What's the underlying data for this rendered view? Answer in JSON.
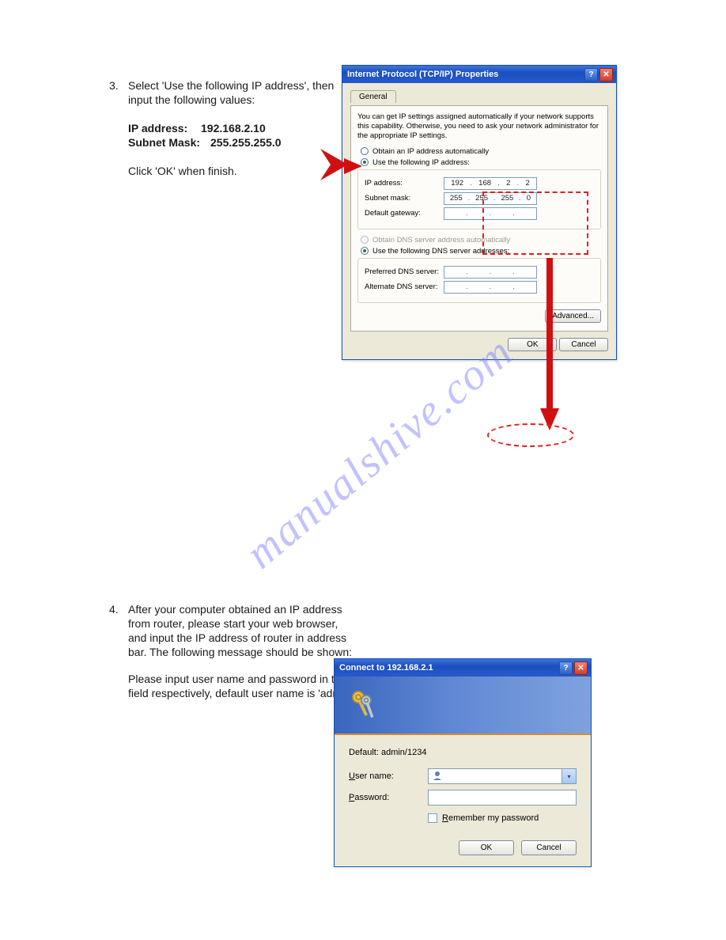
{
  "doc": {
    "step3_num": "3.",
    "step3_text_a": "Select 'Use the following IP address', then",
    "step3_text_b": "input the following values:",
    "ip_label": "IP address:",
    "ip_val": "192.168.2.10",
    "mask_label": "Subnet Mask:",
    "mask_val": "255.255.255.0",
    "step3_click_ok": "Click 'OK' when finish.",
    "step4_num": "4.",
    "step4_a": "After your computer obtained an IP address",
    "step4_b": "from router, please start your web browser,",
    "step4_c": "and input the IP address of router in address",
    "step4_d": "bar. The following message should be shown:",
    "step5": "Please input user name and password in the",
    "step5b": "field respectively, default user name is 'admin',",
    "watermark": "manualshive.com"
  },
  "dlg1": {
    "title": "Internet Protocol (TCP/IP) Properties",
    "tab": "General",
    "intro": "You can get IP settings assigned automatically if your network supports this capability. Otherwise, you need to ask your network administrator for the appropriate IP settings.",
    "r_obtain_ip": "Obtain an IP address automatically",
    "r_use_ip": "Use the following IP address:",
    "lbl_ip": "IP address:",
    "lbl_mask": "Subnet mask:",
    "lbl_gw": "Default gateway:",
    "ip_octets": [
      "192",
      "168",
      "2",
      "2"
    ],
    "mask_octets": [
      "255",
      "255",
      "255",
      "0"
    ],
    "gw_octets": [
      "",
      "",
      "",
      ""
    ],
    "r_obtain_dns": "Obtain DNS server address automatically",
    "r_use_dns": "Use the following DNS server addresses:",
    "lbl_pref_dns": "Preferred DNS server:",
    "lbl_alt_dns": "Alternate DNS server:",
    "pref_dns": [
      "",
      "",
      "",
      ""
    ],
    "alt_dns": [
      "",
      "",
      "",
      ""
    ],
    "btn_adv": "Advanced...",
    "btn_ok": "OK",
    "btn_cancel": "Cancel"
  },
  "dlg2": {
    "title": "Connect to 192.168.2.1",
    "default_line": "Default: admin/1234",
    "lbl_user_pre": "U",
    "lbl_user_post": "ser name:",
    "lbl_pass_pre": "P",
    "lbl_pass_post": "assword:",
    "remember_pre": "R",
    "remember_post": "emember my password",
    "btn_ok": "OK",
    "btn_cancel": "Cancel"
  }
}
